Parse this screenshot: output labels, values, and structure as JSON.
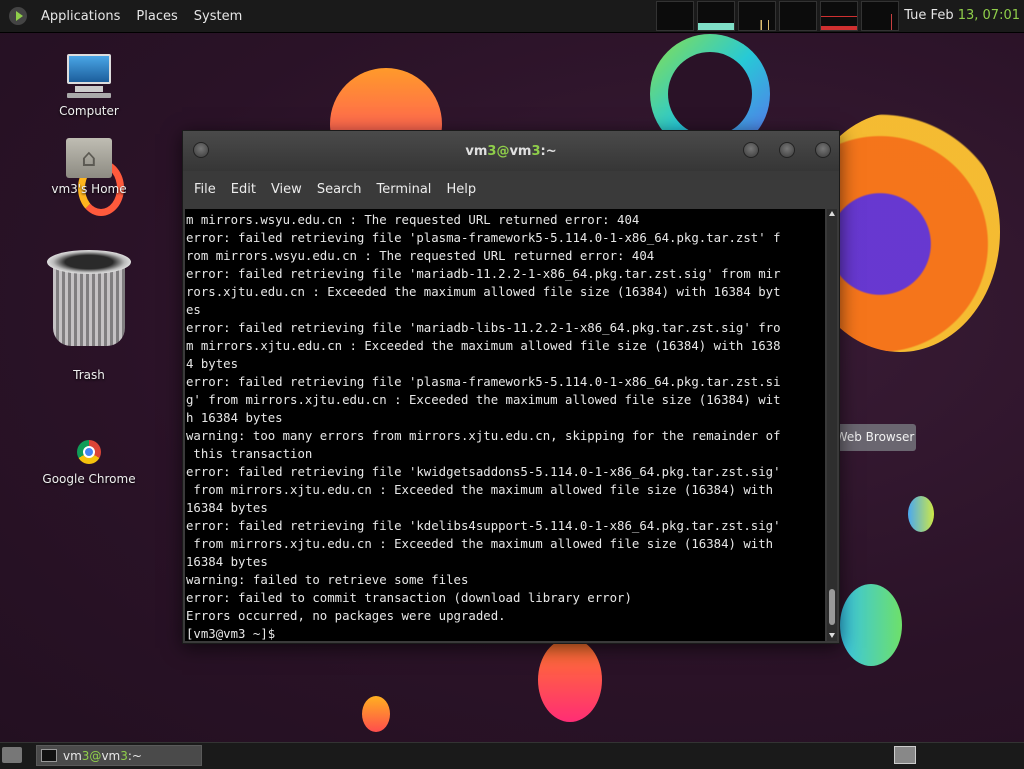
{
  "top_panel": {
    "menus": [
      "Applications",
      "Places",
      "System"
    ],
    "clock_prefix": "Tue Feb ",
    "clock_accent": "13, 07:01",
    "accent_color": "#8fce4a"
  },
  "desktop": {
    "icons": [
      {
        "label": "Computer",
        "icon": "computer-icon"
      },
      {
        "label": "vm3's Home",
        "icon": "home-folder-icon"
      },
      {
        "label": "Trash",
        "icon": "trash-icon"
      },
      {
        "label": "Google Chrome",
        "icon": "chrome-icon"
      }
    ],
    "tooltip": "Web Browser"
  },
  "terminal": {
    "title_pre": "vm",
    "title_accent1": "3@",
    "title_mid": "vm",
    "title_accent2": "3",
    "title_post": ":~",
    "menus": [
      "File",
      "Edit",
      "View",
      "Search",
      "Terminal",
      "Help"
    ],
    "lines": [
      "m mirrors.wsyu.edu.cn : The requested URL returned error: 404",
      "error: failed retrieving file 'plasma-framework5-5.114.0-1-x86_64.pkg.tar.zst' f",
      "rom mirrors.wsyu.edu.cn : The requested URL returned error: 404",
      "error: failed retrieving file 'mariadb-11.2.2-1-x86_64.pkg.tar.zst.sig' from mir",
      "rors.xjtu.edu.cn : Exceeded the maximum allowed file size (16384) with 16384 byt",
      "es",
      "error: failed retrieving file 'mariadb-libs-11.2.2-1-x86_64.pkg.tar.zst.sig' fro",
      "m mirrors.xjtu.edu.cn : Exceeded the maximum allowed file size (16384) with 1638",
      "4 bytes",
      "error: failed retrieving file 'plasma-framework5-5.114.0-1-x86_64.pkg.tar.zst.si",
      "g' from mirrors.xjtu.edu.cn : Exceeded the maximum allowed file size (16384) wit",
      "h 16384 bytes",
      "warning: too many errors from mirrors.xjtu.edu.cn, skipping for the remainder of",
      " this transaction",
      "error: failed retrieving file 'kwidgetsaddons5-5.114.0-1-x86_64.pkg.tar.zst.sig'",
      " from mirrors.xjtu.edu.cn : Exceeded the maximum allowed file size (16384) with",
      "16384 bytes",
      "error: failed retrieving file 'kdelibs4support-5.114.0-1-x86_64.pkg.tar.zst.sig'",
      " from mirrors.xjtu.edu.cn : Exceeded the maximum allowed file size (16384) with",
      "16384 bytes",
      "warning: failed to retrieve some files",
      "error: failed to commit transaction (download library error)",
      "Errors occurred, no packages were upgraded.",
      "[vm3@vm3 ~]$ "
    ]
  },
  "bottom_panel": {
    "task_pre": "vm",
    "task_accent": "3@",
    "task_mid": "vm",
    "task_accent2": "3",
    "task_post": ":~"
  }
}
